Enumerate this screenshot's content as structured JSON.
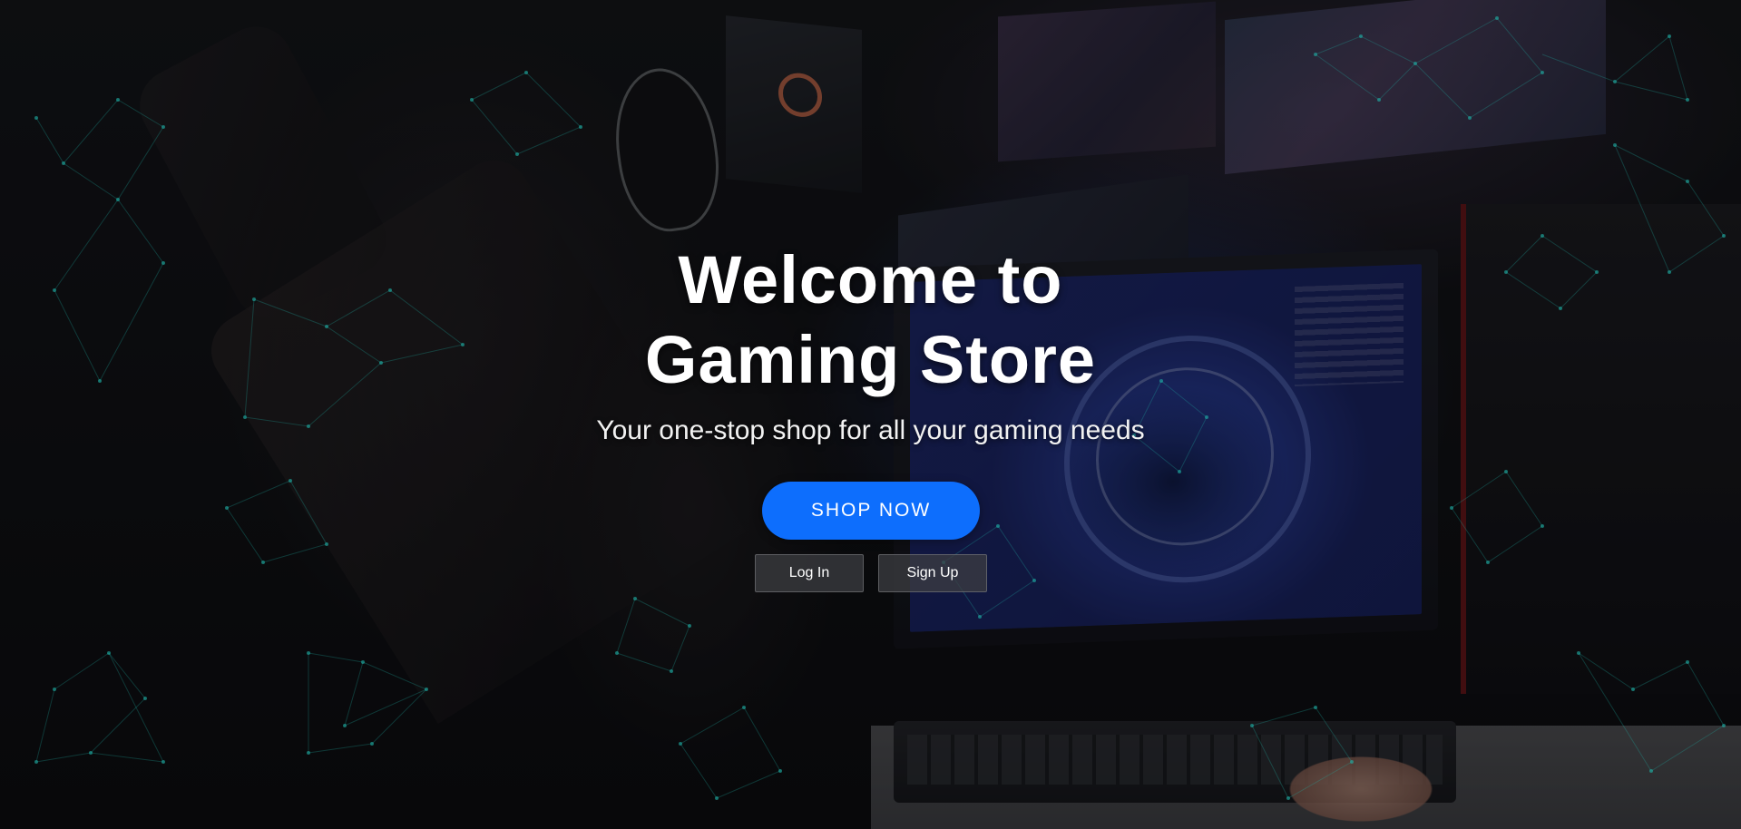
{
  "hero": {
    "title_line1": "Welcome to",
    "title_line2": "Gaming Store",
    "subtitle": "Your one-stop shop for all your gaming needs",
    "shop_button_label": "SHOP NOW",
    "login_label": "Log In",
    "signup_label": "Sign Up"
  },
  "colors": {
    "accent": "#0d6efd",
    "text": "#ffffff",
    "network_lines": "#1fb3a8"
  }
}
